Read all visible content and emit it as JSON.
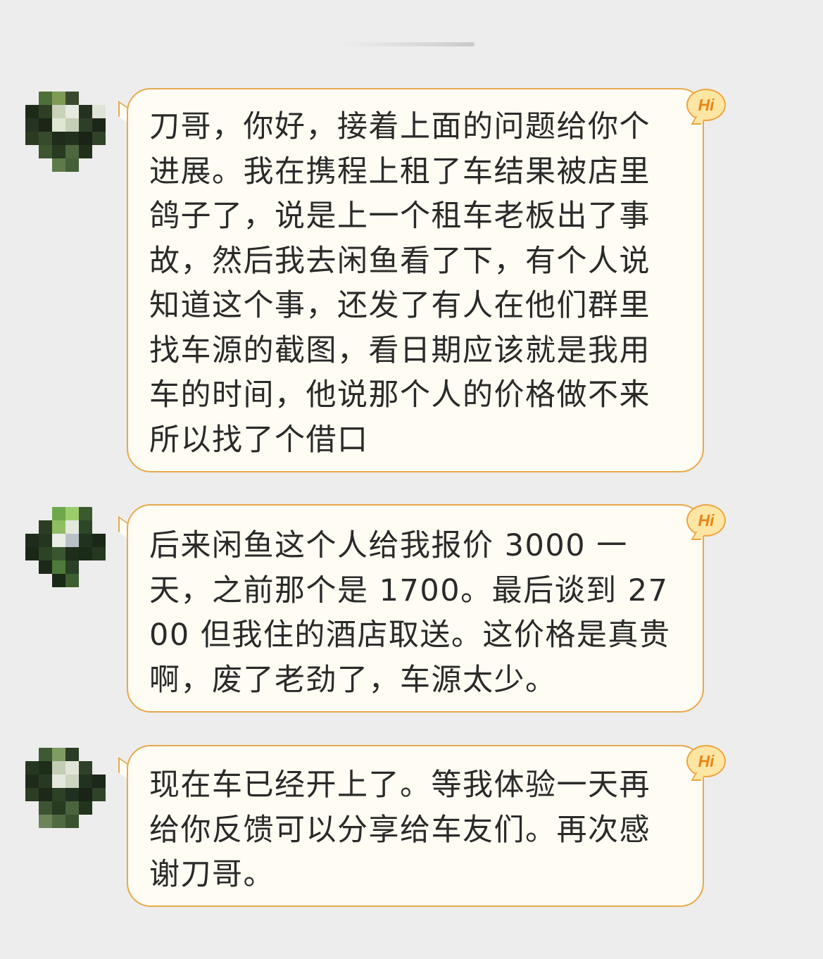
{
  "messages": [
    {
      "avatar": "pixelated-avatar",
      "badge": "Hi",
      "text": "刀哥，你好，接着上面的问题给你个进展。我在携程上租了车结果被店里鸽子了，说是上一个租车老板出了事故，然后我去闲鱼看了下，有个人说知道这个事，还发了有人在他们群里找车源的截图，看日期应该就是我用车的时间，他说那个人的价格做不来所以找了个借口"
    },
    {
      "avatar": "pixelated-avatar",
      "badge": "Hi",
      "text": "后来闲鱼这个人给我报价 3000 一天，之前那个是 1700。最后谈到 2700 但我住的酒店取送。这价格是真贵啊，废了老劲了，车源太少。"
    },
    {
      "avatar": "pixelated-avatar",
      "badge": "Hi",
      "text": "现在车已经开上了。等我体验一天再给你反馈可以分享给车友们。再次感谢刀哥。"
    }
  ],
  "colors": {
    "background": "#ededed",
    "bubble_fill": "#fefcf3",
    "bubble_border": "#e7a94d",
    "badge_text": "#e98516"
  }
}
